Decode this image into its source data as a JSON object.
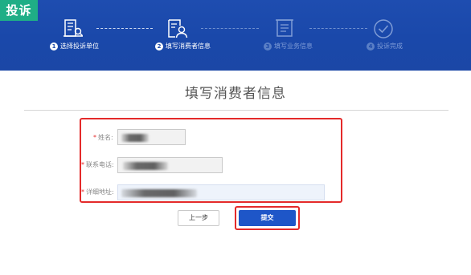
{
  "header": {
    "tag": "投诉"
  },
  "steps": [
    {
      "num": "1",
      "label": "选择投诉单位",
      "icon": "building-search-icon",
      "state": "active"
    },
    {
      "num": "2",
      "label": "填写消费者信息",
      "icon": "person-form-icon",
      "state": "active"
    },
    {
      "num": "3",
      "label": "填写业务信息",
      "icon": "document-icon",
      "state": "inactive"
    },
    {
      "num": "4",
      "label": "投诉完成",
      "icon": "check-circle-icon",
      "state": "inactive"
    }
  ],
  "colors": {
    "header_bg": "#1a48aa",
    "tag_bg": "#1fae86",
    "accent": "#1e56c8",
    "highlight": "#e42a2a"
  },
  "page": {
    "title": "填写消费者信息"
  },
  "form": {
    "name_label": "姓名:",
    "phone_label": "联系电话:",
    "address_label": "详细地址:",
    "required_mark": "*"
  },
  "buttons": {
    "prev": "上一步",
    "submit": "提交"
  }
}
